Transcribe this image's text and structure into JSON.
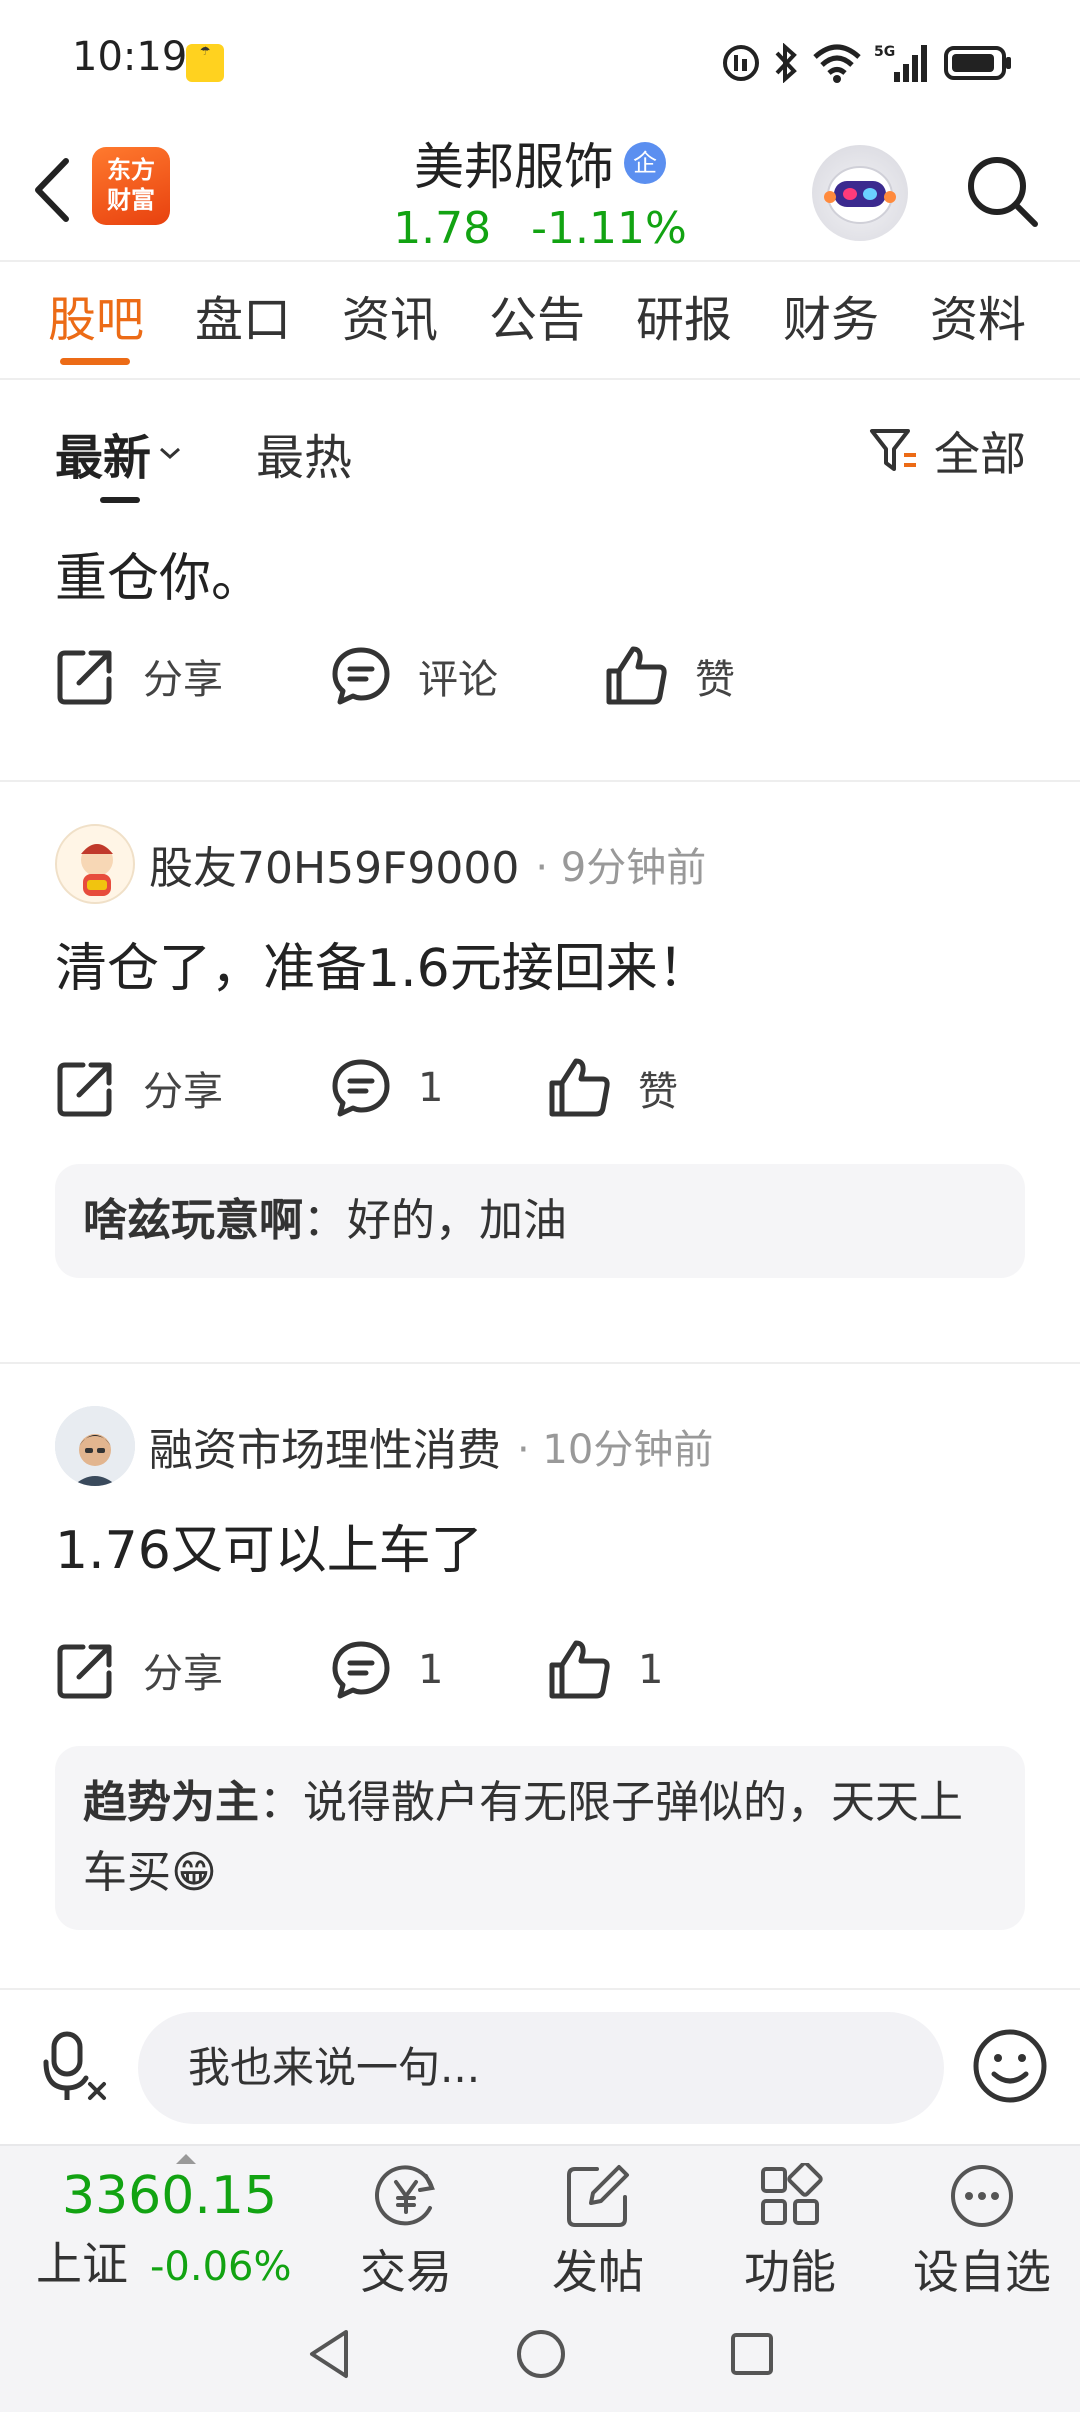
{
  "status_bar": {
    "time": "10:19",
    "app_notification_icon": "weather-app-icon",
    "network": "5G"
  },
  "header": {
    "brand_logo_text": "东方\n财富",
    "stock_name": "美邦服饰",
    "enterprise_badge": "企",
    "price": "1.78",
    "change_percent": "-1.11%",
    "price_color": "#12a312"
  },
  "tabs": [
    {
      "label": "股吧",
      "active": true
    },
    {
      "label": "盘口"
    },
    {
      "label": "资讯"
    },
    {
      "label": "公告"
    },
    {
      "label": "研报"
    },
    {
      "label": "财务"
    },
    {
      "label": "资料"
    }
  ],
  "sort": {
    "latest": "最新",
    "hot": "最热",
    "filter": "全部"
  },
  "posts": [
    {
      "content": "重仓你。",
      "actions": {
        "share": "分享",
        "comment": "评论",
        "like": "赞"
      }
    },
    {
      "user": "股友70H59F9000",
      "time": "· 9分钟前",
      "content": "清仓了，准备1.6元接回来！",
      "actions": {
        "share": "分享",
        "comment": "1",
        "like": "赞"
      },
      "reply": {
        "user": "啥兹玩意啊",
        "text": "：好的，加油"
      }
    },
    {
      "user": "融资市场理性消费",
      "time": "· 10分钟前",
      "content": "1.76又可以上车了",
      "actions": {
        "share": "分享",
        "comment": "1",
        "like": "1"
      },
      "reply": {
        "user": "趋势为主",
        "text": "：说得散户有无限子弹似的，天天上车买😁"
      }
    }
  ],
  "comment_bar": {
    "placeholder": "我也来说一句..."
  },
  "bottom_nav": {
    "index_value": "3360.15",
    "index_name": "上证",
    "index_change": "-0.06%",
    "items": [
      {
        "label": "交易",
        "icon": "yen-exchange-icon"
      },
      {
        "label": "发帖",
        "icon": "edit-post-icon"
      },
      {
        "label": "功能",
        "icon": "grid-apps-icon"
      },
      {
        "label": "设自选",
        "icon": "more-circle-icon"
      }
    ]
  },
  "colors": {
    "accent": "#ec6b16",
    "down_green": "#12a312"
  }
}
